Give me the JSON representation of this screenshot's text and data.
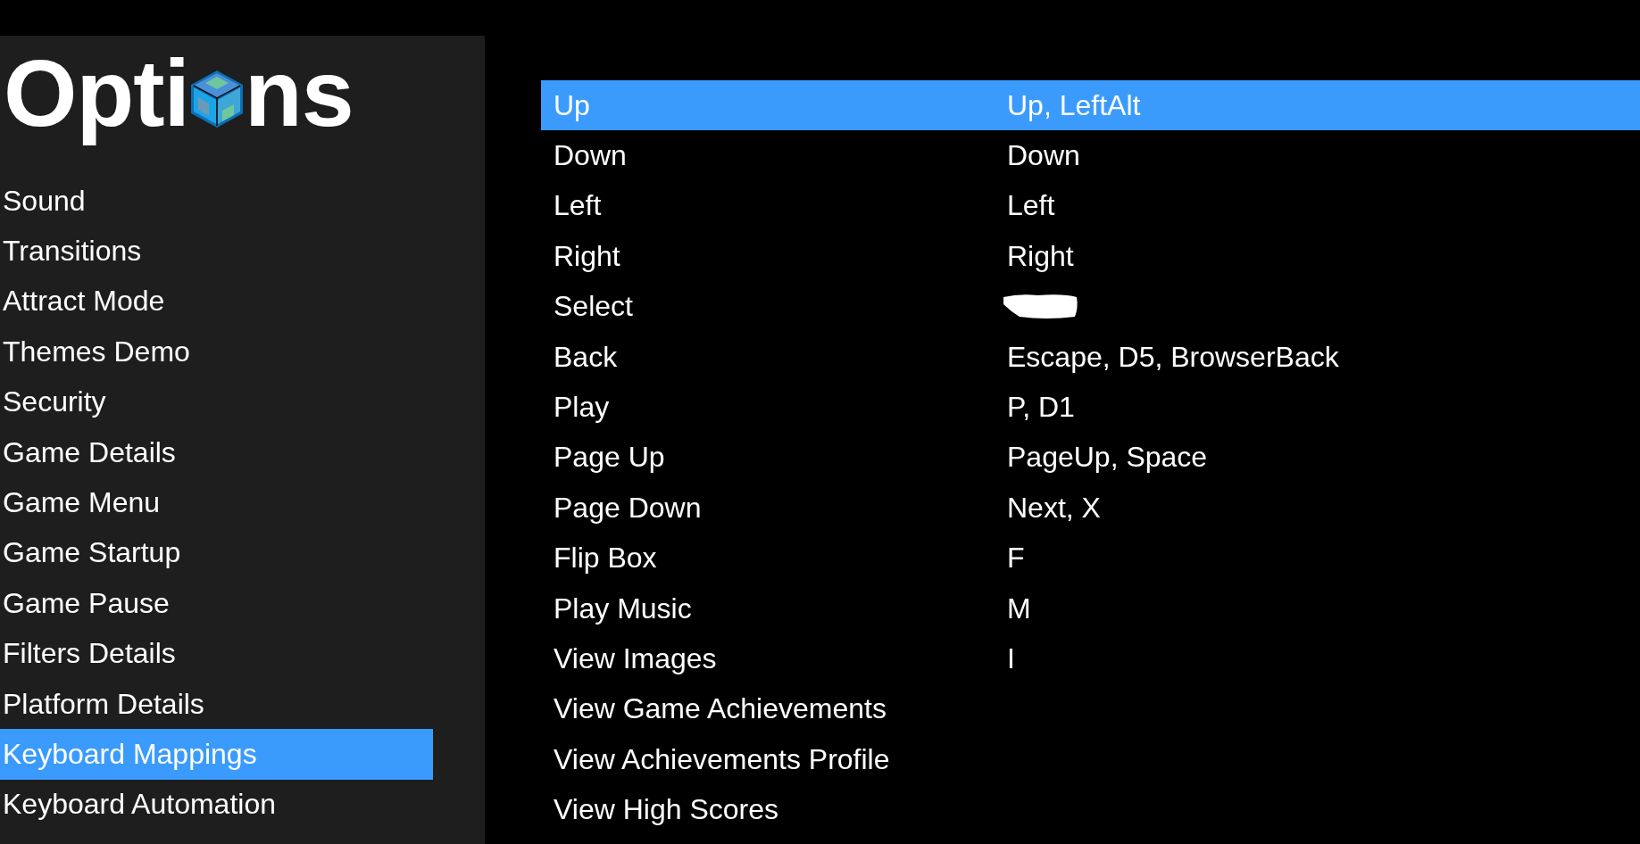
{
  "sidebar": {
    "title_parts": [
      "Opti",
      "ns"
    ],
    "items": [
      {
        "label": "Sound",
        "selected": false
      },
      {
        "label": "Transitions",
        "selected": false
      },
      {
        "label": "Attract Mode",
        "selected": false
      },
      {
        "label": "Themes Demo",
        "selected": false
      },
      {
        "label": "Security",
        "selected": false
      },
      {
        "label": "Game Details",
        "selected": false
      },
      {
        "label": "Game Menu",
        "selected": false
      },
      {
        "label": "Game Startup",
        "selected": false
      },
      {
        "label": "Game Pause",
        "selected": false
      },
      {
        "label": "Filters Details",
        "selected": false
      },
      {
        "label": "Platform Details",
        "selected": false
      },
      {
        "label": "Keyboard Mappings",
        "selected": true
      },
      {
        "label": "Keyboard Automation",
        "selected": false
      }
    ]
  },
  "mappings": [
    {
      "action": "Up",
      "keys": "Up, LeftAlt",
      "selected": true
    },
    {
      "action": "Down",
      "keys": "Down",
      "selected": false
    },
    {
      "action": "Left",
      "keys": "Left",
      "selected": false
    },
    {
      "action": "Right",
      "keys": "Right",
      "selected": false
    },
    {
      "action": "Select",
      "redacted": true,
      "selected": false
    },
    {
      "action": "Back",
      "keys": "Escape, D5, BrowserBack",
      "selected": false
    },
    {
      "action": "Play",
      "keys": "P, D1",
      "selected": false
    },
    {
      "action": "Page Up",
      "keys": "PageUp, Space",
      "selected": false
    },
    {
      "action": "Page Down",
      "keys": "Next, X",
      "selected": false
    },
    {
      "action": "Flip Box",
      "keys": "F",
      "selected": false
    },
    {
      "action": "Play Music",
      "keys": "M",
      "selected": false
    },
    {
      "action": "View Images",
      "keys": "I",
      "selected": false
    },
    {
      "action": "View Game Achievements",
      "selected": false
    },
    {
      "action": "View Achievements Profile",
      "selected": false
    },
    {
      "action": "View High Scores",
      "selected": false
    }
  ]
}
